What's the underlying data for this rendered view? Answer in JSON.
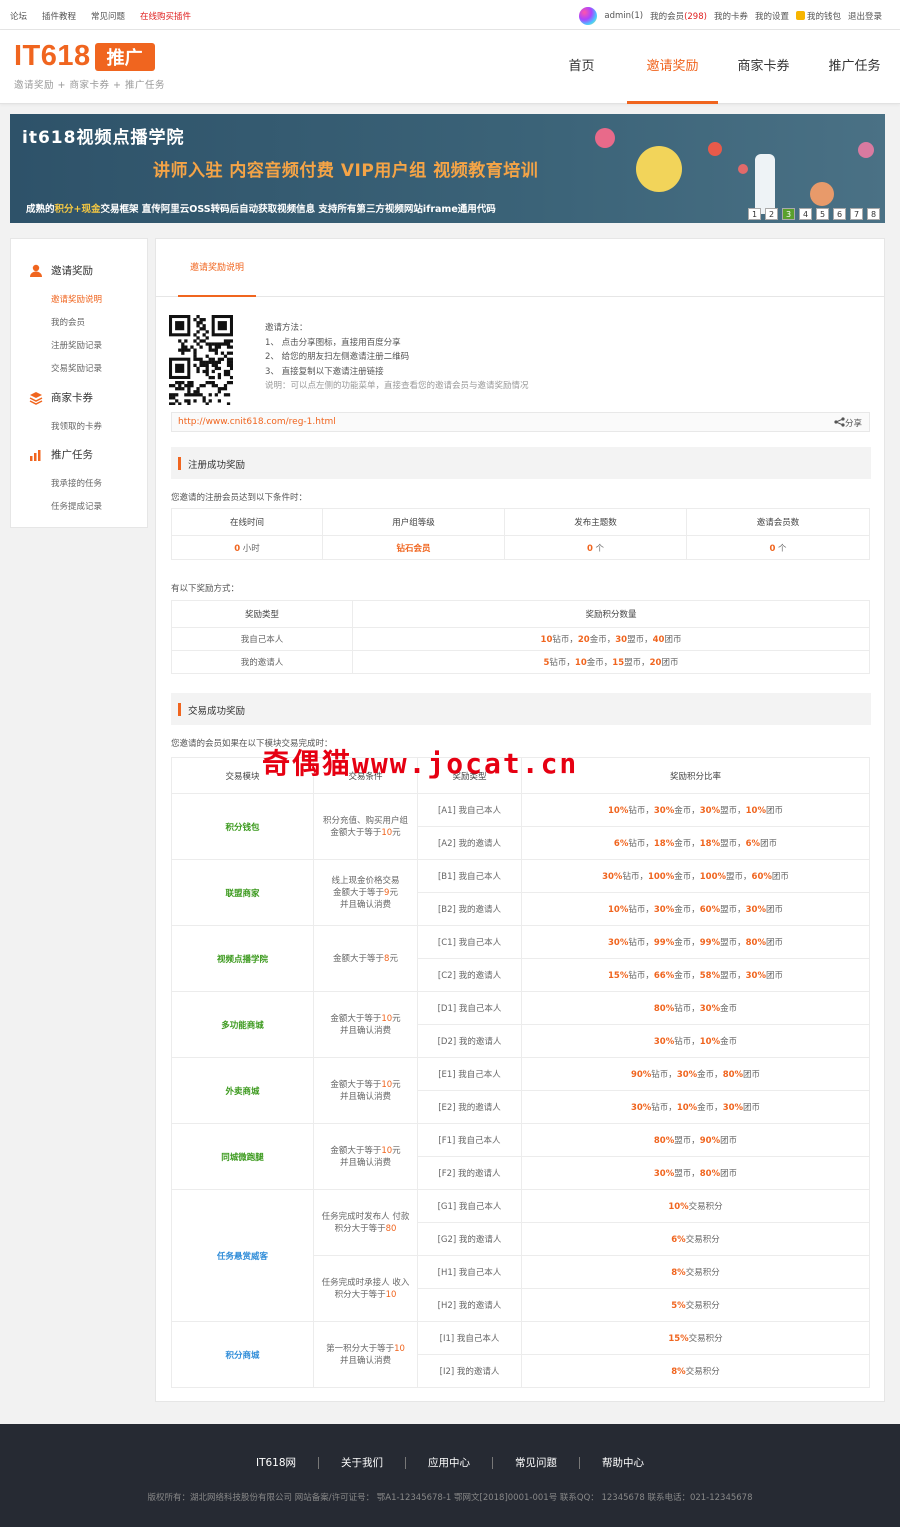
{
  "topbar": {
    "left_links": [
      "论坛",
      "插件教程",
      "常见问题",
      "在线购买插件"
    ],
    "user": "admin(1)",
    "my_members": "我的会员",
    "members_count": "(298)",
    "links": [
      "我的卡券",
      "我的设置",
      "我的钱包",
      "退出登录"
    ]
  },
  "header": {
    "logo_text": "IT618",
    "logo_badge": "推广",
    "logo_sub": "邀请奖励 + 商家卡券 + 推广任务",
    "nav": [
      "首页",
      "邀请奖励",
      "商家卡券",
      "推广任务"
    ],
    "nav_active": "邀请奖励"
  },
  "banner": {
    "title": "it618视频点播学院",
    "slogan": "讲师入驻  内容音频付费  VIP用户组  视频教育培训",
    "bottom_pre": "成熟的",
    "bottom_hl": "积分+现金",
    "bottom_post": "交易框架    直传阿里云OSS转码后自动获取视频信息    支持所有第三方视频网站iframe通用代码",
    "pages": [
      "1",
      "2",
      "3",
      "4",
      "5",
      "6",
      "7",
      "8"
    ],
    "active_page": "3"
  },
  "sidebar": {
    "groups": [
      {
        "label": "邀请奖励",
        "icon": "user-icon",
        "items": [
          "邀请奖励说明",
          "我的会员",
          "注册奖励记录",
          "交易奖励记录"
        ]
      },
      {
        "label": "商家卡券",
        "icon": "layers-icon",
        "items": [
          "我领取的卡券"
        ]
      },
      {
        "label": "推广任务",
        "icon": "bar-chart-icon",
        "items": [
          "我承接的任务",
          "任务提成记录"
        ]
      }
    ],
    "active_item": "邀请奖励说明"
  },
  "main": {
    "tab": "邀请奖励说明",
    "method_title": "邀请方法：",
    "method_lines": [
      "1、 点击分享图标，直接用百度分享",
      "2、 给您的朋友扫左侧邀请注册二维码",
      "3、 直接复制以下邀请注册链接"
    ],
    "method_note": "说明：可以点左侧的功能菜单，直接查看您的邀请会员与邀请奖励情况",
    "invite_url": "http://www.cnit618.com/reg-1.html",
    "share_label": "分享",
    "reg_section": "注册成功奖励",
    "reg_condition_caption": "您邀请的注册会员达到以下条件时：",
    "reg_headers": [
      "在线时间",
      "用户组等级",
      "发布主题数",
      "邀请会员数"
    ],
    "reg_values": [
      {
        "value": "0",
        "unit": " 小时"
      },
      {
        "value": "钻石会员",
        "unit": ""
      },
      {
        "value": "0",
        "unit": " 个"
      },
      {
        "value": "0",
        "unit": " 个"
      }
    ],
    "reward_caption": "有以下奖励方式：",
    "reward_headers": [
      "奖励类型",
      "奖励积分数量"
    ],
    "reward_rows": [
      {
        "type": "我自己本人",
        "parts": [
          [
            "10",
            "钻币，"
          ],
          [
            "20",
            "金币，"
          ],
          [
            "30",
            "盟币，"
          ],
          [
            "40",
            "团币"
          ]
        ]
      },
      {
        "type": "我的邀请人",
        "parts": [
          [
            "5",
            "钻币，"
          ],
          [
            "10",
            "金币，"
          ],
          [
            "15",
            "盟币，"
          ],
          [
            "20",
            "团币"
          ]
        ]
      }
    ],
    "trade_section": "交易成功奖励",
    "trade_caption": "您邀请的会员如果在以下模块交易完成时：",
    "trade_headers": [
      "交易模块",
      "交易条件",
      "奖励类型",
      "奖励积分比率"
    ],
    "trade_groups": [
      {
        "module": "积分钱包",
        "color": "gr",
        "cond": [
          "积分充值、购买用户组",
          "金额大于等于10元"
        ],
        "rows": [
          {
            "type": "[A1] 我自己本人",
            "parts": [
              [
                "10%",
                "钻币，"
              ],
              [
                "30%",
                "金币，"
              ],
              [
                "30%",
                "盟币，"
              ],
              [
                "10%",
                "团币"
              ]
            ]
          },
          {
            "type": "[A2] 我的邀请人",
            "parts": [
              [
                "6%",
                "钻币，"
              ],
              [
                "18%",
                "金币，"
              ],
              [
                "18%",
                "盟币，"
              ],
              [
                "6%",
                "团币"
              ]
            ]
          }
        ]
      },
      {
        "module": "联盟商家",
        "color": "gr",
        "cond": [
          "线上现金价格交易",
          "金额大于等于9元",
          "并且确认消费"
        ],
        "rows": [
          {
            "type": "[B1] 我自己本人",
            "parts": [
              [
                "30%",
                "钻币，"
              ],
              [
                "100%",
                "金币，"
              ],
              [
                "100%",
                "盟币，"
              ],
              [
                "60%",
                "团币"
              ]
            ]
          },
          {
            "type": "[B2] 我的邀请人",
            "parts": [
              [
                "10%",
                "钻币，"
              ],
              [
                "30%",
                "金币，"
              ],
              [
                "60%",
                "盟币，"
              ],
              [
                "30%",
                "团币"
              ]
            ]
          }
        ]
      },
      {
        "module": "视频点播学院",
        "color": "gr",
        "cond": [
          "金额大于等于8元"
        ],
        "rows": [
          {
            "type": "[C1] 我自己本人",
            "parts": [
              [
                "30%",
                "钻币，"
              ],
              [
                "99%",
                "金币，"
              ],
              [
                "99%",
                "盟币，"
              ],
              [
                "80%",
                "团币"
              ]
            ]
          },
          {
            "type": "[C2] 我的邀请人",
            "parts": [
              [
                "15%",
                "钻币，"
              ],
              [
                "66%",
                "金币，"
              ],
              [
                "58%",
                "盟币，"
              ],
              [
                "30%",
                "团币"
              ]
            ]
          }
        ]
      },
      {
        "module": "多功能商城",
        "color": "gr",
        "cond": [
          "金额大于等于10元",
          "并且确认消费"
        ],
        "rows": [
          {
            "type": "[D1] 我自己本人",
            "parts": [
              [
                "80%",
                "钻币，"
              ],
              [
                "30%",
                "金币"
              ]
            ]
          },
          {
            "type": "[D2] 我的邀请人",
            "parts": [
              [
                "30%",
                "钻币，"
              ],
              [
                "10%",
                "金币"
              ]
            ]
          }
        ]
      },
      {
        "module": "外卖商城",
        "color": "gr",
        "cond": [
          "金额大于等于10元",
          "并且确认消费"
        ],
        "rows": [
          {
            "type": "[E1] 我自己本人",
            "parts": [
              [
                "90%",
                "钻币，"
              ],
              [
                "30%",
                "金币，"
              ],
              [
                "80%",
                "团币"
              ]
            ]
          },
          {
            "type": "[E2] 我的邀请人",
            "parts": [
              [
                "30%",
                "钻币，"
              ],
              [
                "10%",
                "金币，"
              ],
              [
                "30%",
                "团币"
              ]
            ]
          }
        ]
      },
      {
        "module": "同城微跑腿",
        "color": "gr",
        "cond": [
          "金额大于等于10元",
          "并且确认消费"
        ],
        "rows": [
          {
            "type": "[F1] 我自己本人",
            "parts": [
              [
                "80%",
                "盟币，"
              ],
              [
                "90%",
                "团币"
              ]
            ]
          },
          {
            "type": "[F2] 我的邀请人",
            "parts": [
              [
                "30%",
                "盟币，"
              ],
              [
                "80%",
                "团币"
              ]
            ]
          }
        ]
      },
      {
        "module": "任务悬赏威客",
        "color": "bl",
        "cond": [
          "任务完成时发布人 付款",
          "积分大于等于80"
        ],
        "rows": [
          {
            "type": "[G1] 我自己本人",
            "parts": [
              [
                "10%",
                "交易积分"
              ]
            ]
          },
          {
            "type": "[G2] 我的邀请人",
            "parts": [
              [
                "6%",
                "交易积分"
              ]
            ]
          }
        ],
        "cond2": [
          "任务完成时承接人 收入",
          "积分大于等于10"
        ],
        "rows2": [
          {
            "type": "[H1] 我自己本人",
            "parts": [
              [
                "8%",
                "交易积分"
              ]
            ]
          },
          {
            "type": "[H2] 我的邀请人",
            "parts": [
              [
                "5%",
                "交易积分"
              ]
            ]
          }
        ]
      },
      {
        "module": "积分商城",
        "color": "bl",
        "cond": [
          "第一积分大于等于10",
          "并且确认消费"
        ],
        "rows": [
          {
            "type": "[I1] 我自己本人",
            "parts": [
              [
                "15%",
                "交易积分"
              ]
            ]
          },
          {
            "type": "[I2] 我的邀请人",
            "parts": [
              [
                "8%",
                "交易积分"
              ]
            ]
          }
        ]
      }
    ]
  },
  "watermark": "奇偶猫www.jocat.cn",
  "footer": {
    "links": [
      "IT618网",
      "关于我们",
      "应用中心",
      "常见问题",
      "帮助中心"
    ],
    "copyright": "版权所有：湖北网络科技股份有限公司 网站备案/许可证号： 鄂A1-12345678-1 鄂网文[2018]0001-001号 联系QQ： 12345678 联系电话：021-12345678"
  },
  "colors": {
    "accent": "#f0651f",
    "green": "#3c9a1e",
    "blue": "#2f8cd8",
    "banner": "#2e5269",
    "footer": "#262a33"
  }
}
